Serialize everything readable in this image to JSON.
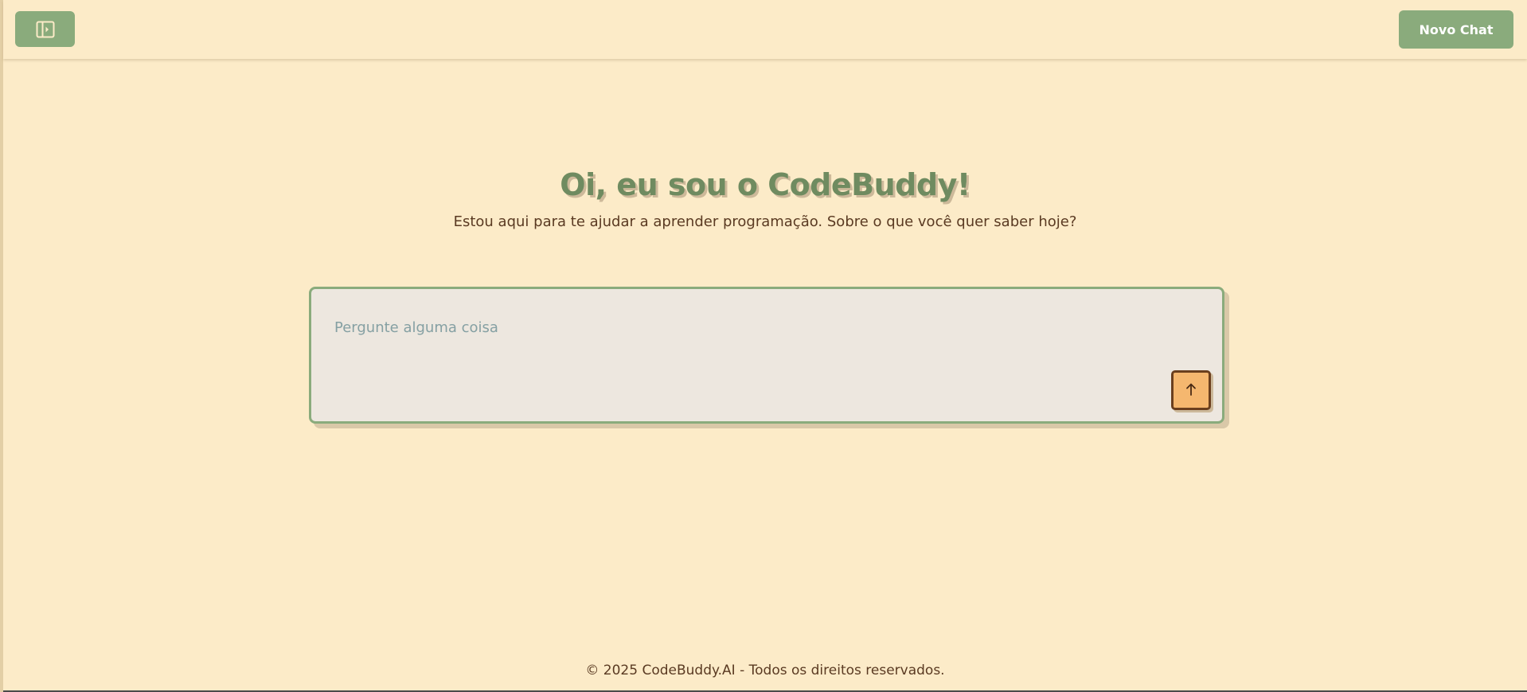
{
  "header": {
    "new_chat_label": "Novo Chat",
    "sidebar_toggle_icon": "sidebar-toggle-icon"
  },
  "hero": {
    "title": "Oi, eu sou o CodeBuddy!",
    "subtitle": "Estou aqui para te ajudar a aprender programação. Sobre o que você quer saber hoje?"
  },
  "composer": {
    "placeholder": "Pergunte alguma coisa",
    "value": "",
    "send_icon": "arrow-up-icon"
  },
  "footer": {
    "text": "© 2025 CodeBuddy.AI - Todos os direitos reservados."
  },
  "colors": {
    "background": "#fcebc8",
    "accent_green": "#8aab7c",
    "title_green": "#6f8b60",
    "send_orange": "#f5b76f",
    "text_brown": "#5a3a22"
  }
}
